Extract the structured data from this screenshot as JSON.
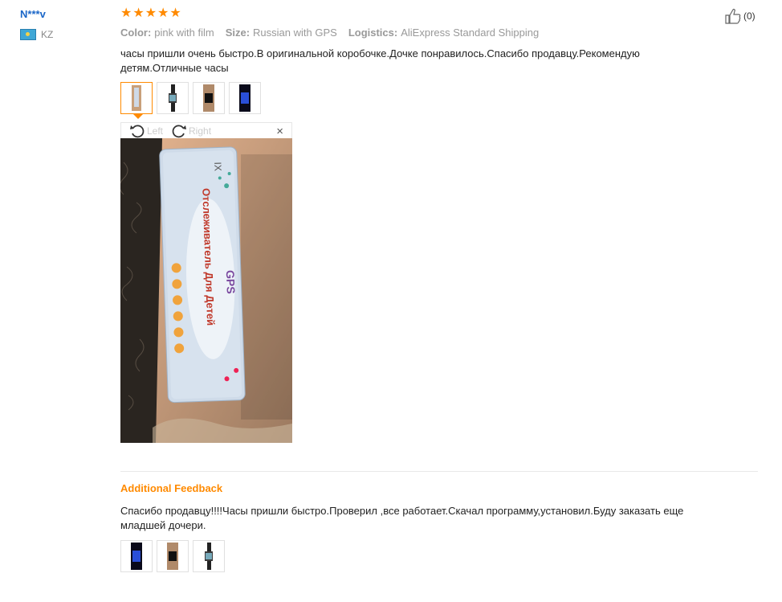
{
  "review": {
    "user_name": "N***v",
    "country_code": "KZ",
    "rating": 5,
    "helpful_count": "(0)",
    "meta": [
      {
        "label": "Color:",
        "value": "pink with film"
      },
      {
        "label": "Size:",
        "value": "Russian with GPS"
      },
      {
        "label": "Logistics:",
        "value": "AliExpress Standard Shipping"
      }
    ],
    "text": "часы пришли очень быстро.В оригинальной коробочке.Дочке понравилось.Спасибо продавцу.Рекомендую детям.Отличные часы",
    "photos": [
      "box-photo",
      "watch-photo",
      "watch-wrist-photo",
      "watch-screen-photo"
    ],
    "viewer": {
      "rotate_left_label": "Left",
      "rotate_right_label": "Right",
      "close_label": "×",
      "box_brand": "IX",
      "box_title_gps": "GPS",
      "box_title_line": "Отслеживатель Для Детей"
    }
  },
  "additional_feedback": {
    "title": "Additional Feedback",
    "text": "Спасибо продавцу!!!!Часы пришли быстро.Проверил ,все работает.Скачал программу,установил.Буду заказать еще младшей дочери.",
    "photos": [
      "watch-screen-photo",
      "watch-wrist-photo",
      "watch-photo"
    ]
  },
  "colors": {
    "accent": "#ff8a00",
    "link": "#1a66c8"
  }
}
